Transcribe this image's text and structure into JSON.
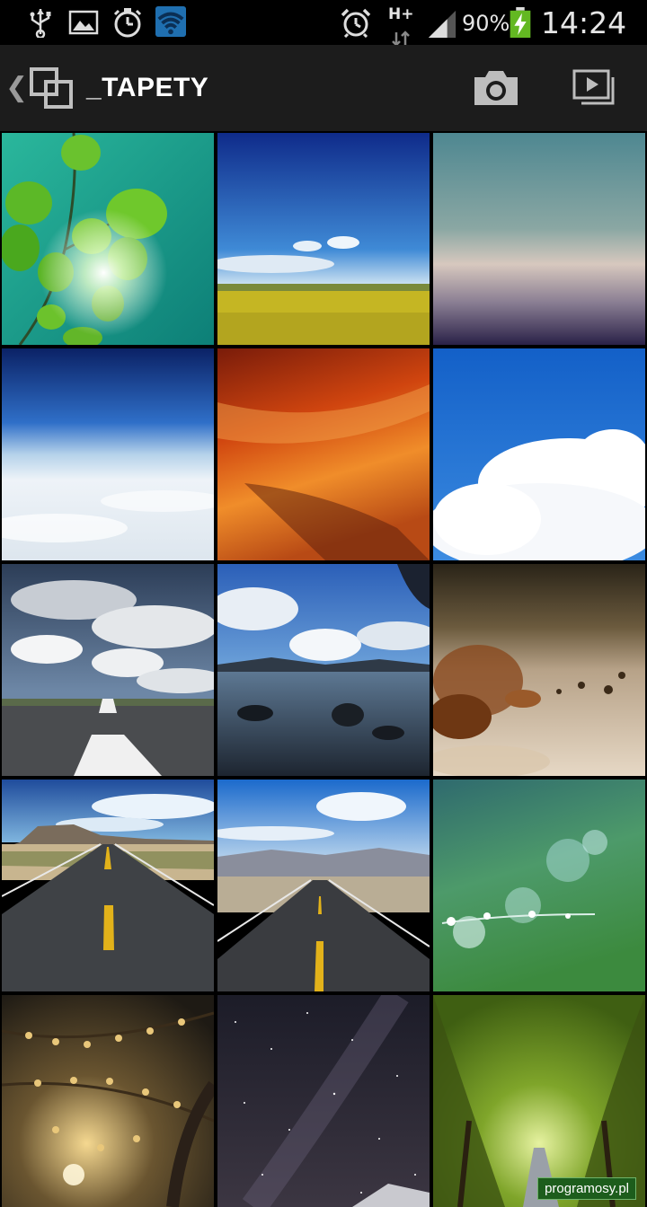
{
  "status_bar": {
    "icons": [
      "usb-icon",
      "image-notification-icon",
      "stopwatch-icon",
      "wifi-icon",
      "alarm-icon",
      "hplus-data-icon",
      "signal-icon",
      "battery-charging-icon"
    ],
    "network": "H+",
    "battery": "90%",
    "time": "14:24"
  },
  "action_bar": {
    "back_icon": "back-caret-icon",
    "album_icon": "album-stack-icon",
    "title": "_TAPETY",
    "camera_icon": "camera-icon",
    "slideshow_icon": "slideshow-icon"
  },
  "gallery": {
    "thumbnails": [
      {
        "name": "green-leaves-sun"
      },
      {
        "name": "rapeseed-field-blue-sky"
      },
      {
        "name": "gradient-teal-purple"
      },
      {
        "name": "above-clouds-blue"
      },
      {
        "name": "orange-sky-sunset"
      },
      {
        "name": "white-cloud-blue-sky"
      },
      {
        "name": "road-under-stormy-clouds"
      },
      {
        "name": "lake-with-rocks"
      },
      {
        "name": "autumn-leaves-macro"
      },
      {
        "name": "desert-highway-mesa"
      },
      {
        "name": "straight-road-mountains"
      },
      {
        "name": "green-bokeh-dew"
      },
      {
        "name": "golden-blossom-branches"
      },
      {
        "name": "starry-night-sky"
      },
      {
        "name": "green-tree-tunnel"
      }
    ]
  },
  "watermark": "programosy.pl"
}
